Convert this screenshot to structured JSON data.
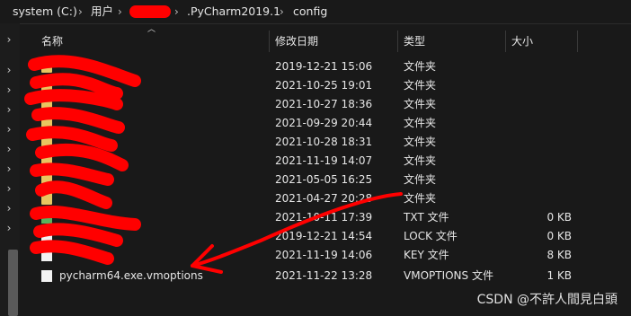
{
  "breadcrumb": {
    "drive": "system (C:)",
    "users": "用户",
    "pycharm": ".PyCharm2019.1",
    "config": "config",
    "separator": "›"
  },
  "columns": {
    "name": "名称",
    "modified": "修改日期",
    "type": "类型",
    "size": "大小"
  },
  "rows": [
    {
      "name": "",
      "modified": "2019-12-21 15:06",
      "type": "文件夹",
      "size": "",
      "icon": "folder-icon"
    },
    {
      "name": "",
      "modified": "2021-10-25 19:01",
      "type": "文件夹",
      "size": "",
      "icon": "folder-icon"
    },
    {
      "name": "",
      "modified": "2021-10-27 18:36",
      "type": "文件夹",
      "size": "",
      "icon": "folder-icon"
    },
    {
      "name": "",
      "modified": "2021-09-29 20:44",
      "type": "文件夹",
      "size": "",
      "icon": "folder-icon"
    },
    {
      "name": "",
      "modified": "2021-10-28 18:31",
      "type": "文件夹",
      "size": "",
      "icon": "folder-icon"
    },
    {
      "name": "",
      "modified": "2021-11-19 14:07",
      "type": "文件夹",
      "size": "",
      "icon": "folder-icon"
    },
    {
      "name": "",
      "modified": "2021-05-05 16:25",
      "type": "文件夹",
      "size": "",
      "icon": "folder-icon"
    },
    {
      "name": "",
      "modified": "2021-04-27 20:28",
      "type": "文件夹",
      "size": "",
      "icon": "folder-icon"
    },
    {
      "name": "",
      "modified": "2021-10-11 17:39",
      "type": "TXT 文件",
      "size": "0 KB",
      "icon": "text-file-icon"
    },
    {
      "name": "",
      "modified": "2019-12-21 14:54",
      "type": "LOCK 文件",
      "size": "0 KB",
      "icon": "file-icon"
    },
    {
      "name": "",
      "modified": "2021-11-19 14:06",
      "type": "KEY 文件",
      "size": "8 KB",
      "icon": "file-icon"
    },
    {
      "name": "pycharm64.exe.vmoptions",
      "modified": "2021-11-22 13:28",
      "type": "VMOPTIONS 文件",
      "size": "1 KB",
      "icon": "file-icon"
    }
  ],
  "watermark": "CSDN @不許人間見白頭",
  "colors": {
    "background": "#191919",
    "folder": "#e8c660",
    "redaction": "#ff0000"
  }
}
